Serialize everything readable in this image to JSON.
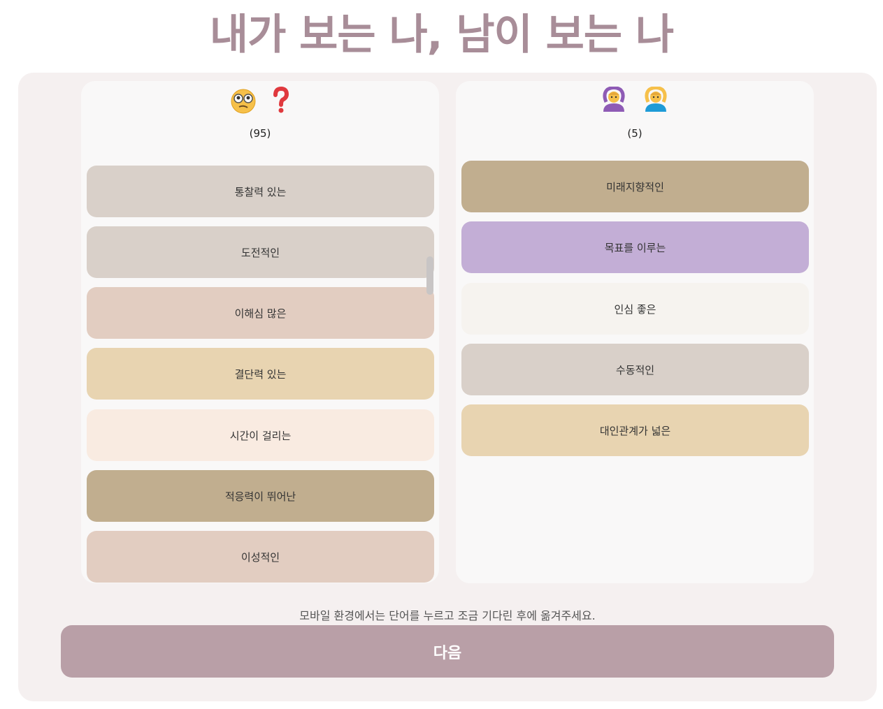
{
  "title": "내가 보는 나, 남이 보는 나",
  "left_column": {
    "icons": [
      "thinking-face-icon",
      "question-mark-icon"
    ],
    "count": "(95)",
    "words": [
      {
        "label": "통찰력 있는",
        "color": "#d9d0c9"
      },
      {
        "label": "도전적인",
        "color": "#d9d0c9"
      },
      {
        "label": "이해심 많은",
        "color": "#e2cdc1"
      },
      {
        "label": "결단력 있는",
        "color": "#e8d4b1"
      },
      {
        "label": "시간이 걸리는",
        "color": "#f9ebe1"
      },
      {
        "label": "적응력이 뛰어난",
        "color": "#c1ae8f"
      },
      {
        "label": "이성적인",
        "color": "#e2cdc1"
      }
    ]
  },
  "right_column": {
    "icons": [
      "person-ok-gesture-icon",
      "person-ok-gesture-icon"
    ],
    "count": "(5)",
    "words": [
      {
        "label": "미래지향적인",
        "color": "#c1ae8f"
      },
      {
        "label": "목표를 이루는",
        "color": "#c3aed6"
      },
      {
        "label": "인심 좋은",
        "color": "#f6f3ef"
      },
      {
        "label": "수동적인",
        "color": "#d9d0c9"
      },
      {
        "label": "대인관계가 넓은",
        "color": "#e8d4b1"
      }
    ]
  },
  "hint": "모바일 환경에서는 단어를 누르고 조금 기다린 후에 옮겨주세요.",
  "next_button": "다음",
  "colors": {
    "title": "#a88d98",
    "panel": "#f5f0f0",
    "button": "#b99fa7"
  }
}
